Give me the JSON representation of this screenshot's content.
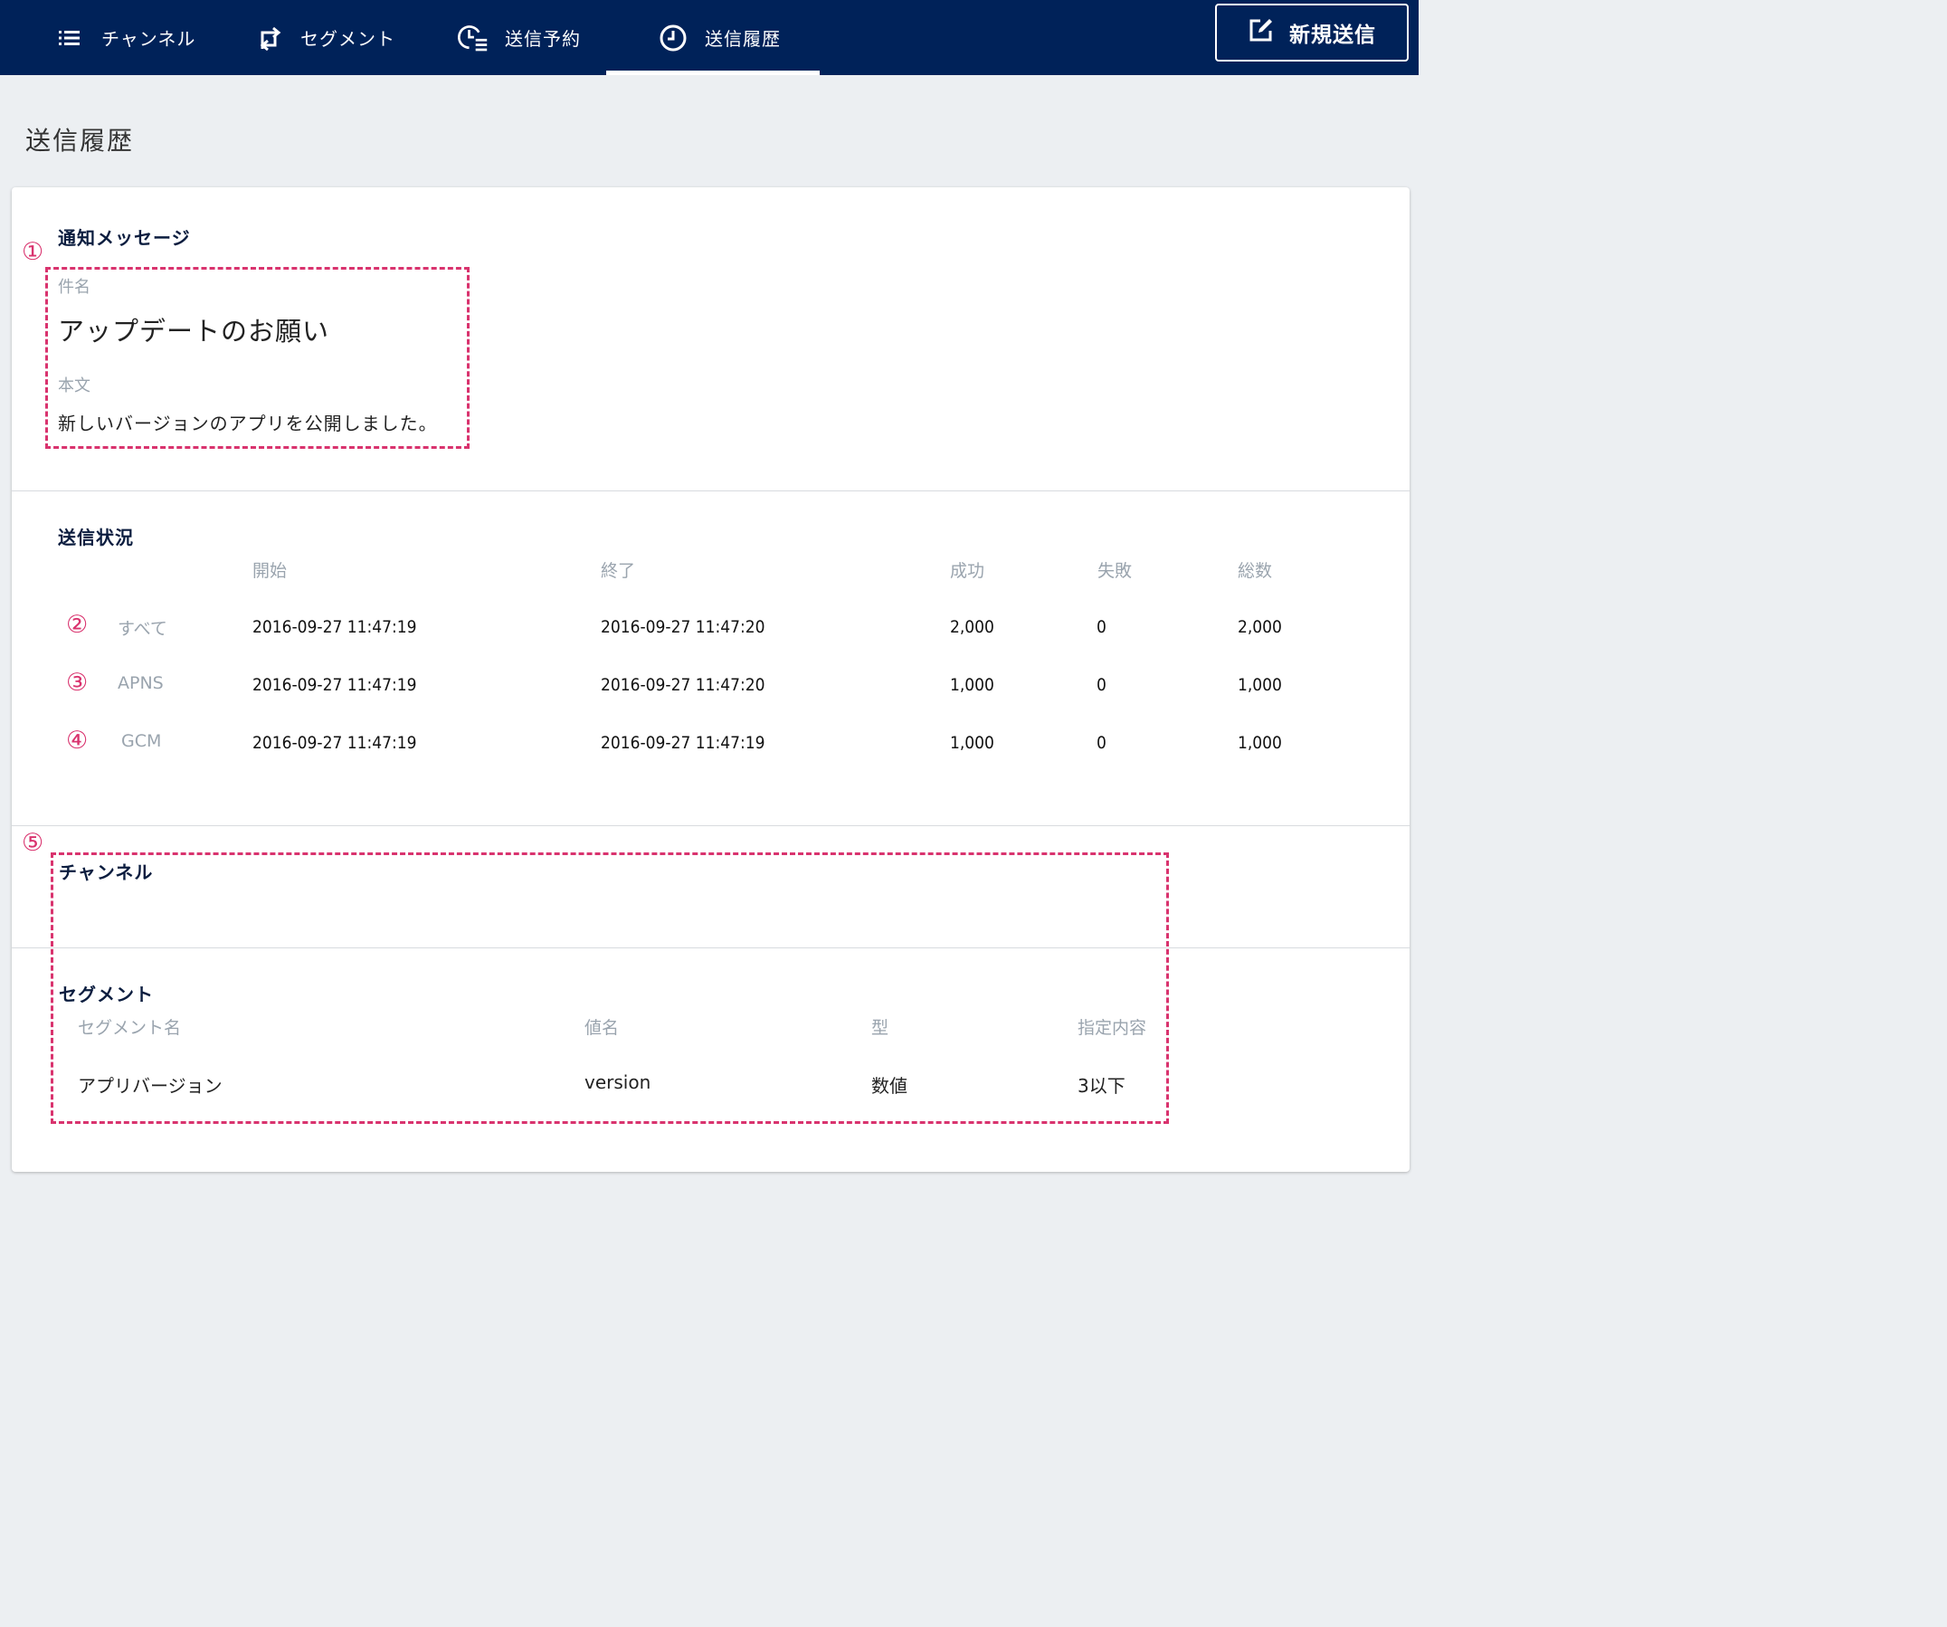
{
  "nav": {
    "items": [
      {
        "label": "チャンネル",
        "icon": "list-icon"
      },
      {
        "label": "セグメント",
        "icon": "swap-icon"
      },
      {
        "label": "送信予約",
        "icon": "schedule-icon"
      },
      {
        "label": "送信履歴",
        "icon": "clock-icon"
      }
    ],
    "active_index": 3,
    "new_button_label": "新規送信"
  },
  "page": {
    "title": "送信履歴"
  },
  "notification": {
    "section_title": "通知メッセージ",
    "marker": "①",
    "subject_label": "件名",
    "subject_value": "アップデートのお願い",
    "body_label": "本文",
    "body_value": "新しいバージョンのアプリを公開しました。"
  },
  "status": {
    "section_title": "送信状況",
    "headers": [
      "開始",
      "終了",
      "成功",
      "失敗",
      "総数"
    ],
    "rows": [
      {
        "marker": "②",
        "label": "すべて",
        "start": "2016-09-27 11:47:19",
        "end": "2016-09-27 11:47:20",
        "success": "2,000",
        "fail": "0",
        "total": "2,000"
      },
      {
        "marker": "③",
        "label": "APNS",
        "start": "2016-09-27 11:47:19",
        "end": "2016-09-27 11:47:20",
        "success": "1,000",
        "fail": "0",
        "total": "1,000"
      },
      {
        "marker": "④",
        "label": "GCM",
        "start": "2016-09-27 11:47:19",
        "end": "2016-09-27 11:47:19",
        "success": "1,000",
        "fail": "0",
        "total": "1,000"
      }
    ]
  },
  "channel": {
    "marker": "⑤",
    "section_title": "チャンネル"
  },
  "segment": {
    "section_title": "セグメント",
    "headers": [
      "セグメント名",
      "値名",
      "型",
      "指定内容"
    ],
    "rows": [
      {
        "name": "アプリバージョン",
        "value_name": "version",
        "type": "数値",
        "condition": "3以下"
      }
    ]
  },
  "colors": {
    "nav_bg": "#002259",
    "annotation": "#d9336e",
    "background": "#eceff2"
  }
}
